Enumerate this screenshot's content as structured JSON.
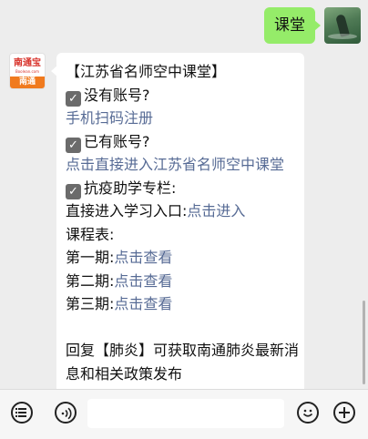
{
  "conversation": {
    "outgoing": {
      "text": "课堂"
    },
    "incoming": {
      "sender_avatar": {
        "brand": "南通宝",
        "brand_sub": "Boolean.com",
        "city": "南通"
      },
      "lines": [
        {
          "text": "【江苏省名师空中课堂】"
        },
        {
          "check": "✓",
          "text": "没有账号?"
        },
        {
          "link": "手机扫码注册"
        },
        {
          "check": "✓",
          "text": "已有账号?"
        },
        {
          "link": "点击直接进入江苏省名师空中课堂"
        },
        {
          "check": "✓",
          "text": "抗疫助学专栏:"
        },
        {
          "text": "直接进入学习入口:",
          "link": "点击进入"
        },
        {
          "text": "课程表:"
        },
        {
          "text": "第一期:",
          "link": "点击查看"
        },
        {
          "text": "第二期:",
          "link": "点击查看"
        },
        {
          "text": "第三期:",
          "link": "点击查看"
        },
        {
          "blank": true
        },
        {
          "text": "回复【肺炎】可获取南通肺炎最新消"
        },
        {
          "text": "息和相关政策发布"
        }
      ]
    }
  },
  "colors": {
    "outgoing_bubble": "#95ec69",
    "incoming_bubble": "#ffffff",
    "link": "#576b95",
    "background": "#ededed"
  },
  "toolbar": {
    "icons": [
      "menu-list-icon",
      "voice-icon",
      "emoji-icon",
      "plus-icon"
    ],
    "input_value": ""
  }
}
